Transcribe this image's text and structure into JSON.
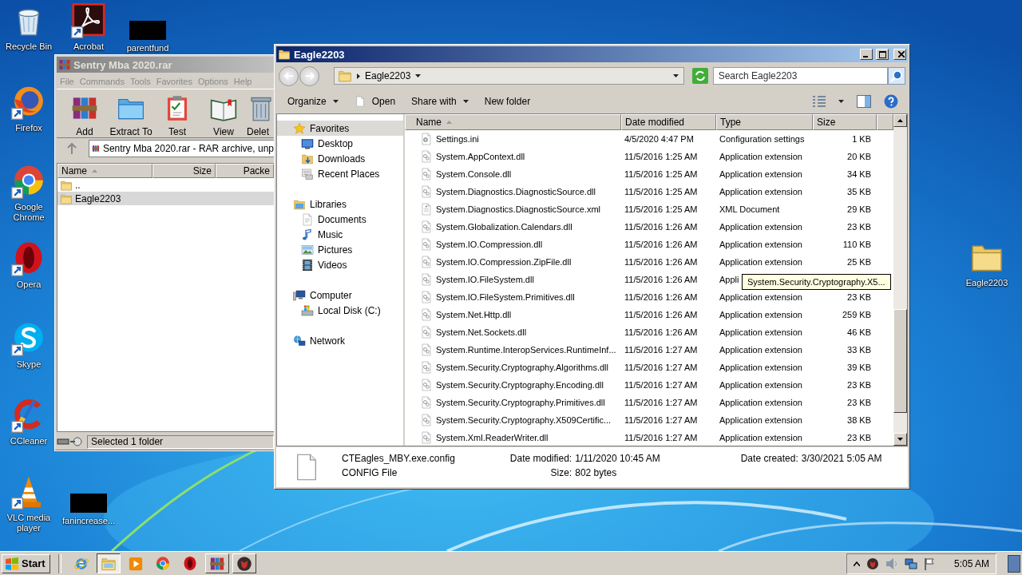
{
  "desktop_icons": [
    {
      "label": "Recycle Bin",
      "kind": "recycle",
      "shortcut": false
    },
    {
      "label": "Acrobat",
      "kind": "acrobat",
      "shortcut": true
    },
    {
      "label": "parentfund",
      "kind": "redacted",
      "shortcut": false
    },
    {
      "label": "Firefox",
      "kind": "firefox",
      "shortcut": true
    },
    {
      "label": "Google Chrome",
      "kind": "chrome",
      "shortcut": true
    },
    {
      "label": "Opera",
      "kind": "opera",
      "shortcut": true
    },
    {
      "label": "Skype",
      "kind": "skype",
      "shortcut": true
    },
    {
      "label": "CCleaner",
      "kind": "ccleaner",
      "shortcut": true
    },
    {
      "label": "VLC media player",
      "kind": "vlc",
      "shortcut": true
    },
    {
      "label": "fanincrease...",
      "kind": "redacted",
      "shortcut": false
    },
    {
      "label": "Eagle2203",
      "kind": "folder",
      "shortcut": false
    }
  ],
  "archiver": {
    "title": "Sentry Mba 2020.rar",
    "menu": [
      "File",
      "Commands",
      "Tools",
      "Favorites",
      "Options",
      "Help"
    ],
    "tools": [
      {
        "label": "Add",
        "kind": "add"
      },
      {
        "label": "Extract To",
        "kind": "extract"
      },
      {
        "label": "Test",
        "kind": "test"
      },
      {
        "label": "View",
        "kind": "view"
      },
      {
        "label": "Delet",
        "kind": "delete"
      }
    ],
    "path": "Sentry Mba 2020.rar - RAR archive, unp",
    "columns": [
      {
        "label": "Name",
        "sorted": true
      },
      {
        "label": "Size",
        "sorted": false
      },
      {
        "label": "Packe",
        "sorted": false
      }
    ],
    "rows": [
      {
        "name": "..",
        "selected": false
      },
      {
        "name": "Eagle2203",
        "selected": true
      }
    ],
    "status": "Selected 1 folder"
  },
  "explorer": {
    "title": "Eagle2203",
    "breadcrumb": "Eagle2203",
    "search": {
      "placeholder": "Search Eagle2203"
    },
    "commands": [
      {
        "label": "Organize",
        "kind": "menu"
      },
      {
        "label": "Open",
        "kind": "file"
      },
      {
        "label": "Share with",
        "kind": "menu"
      },
      {
        "label": "New folder",
        "kind": "plain"
      }
    ],
    "nav": [
      {
        "label": "Favorites",
        "kind": "star",
        "selected": true,
        "children": [
          {
            "label": "Desktop",
            "kind": "desktop",
            "selected": false
          },
          {
            "label": "Downloads",
            "kind": "downloads",
            "selected": false
          },
          {
            "label": "Recent Places",
            "kind": "recent",
            "selected": false
          }
        ]
      },
      {
        "label": "Libraries",
        "kind": "library",
        "selected": false,
        "children": [
          {
            "label": "Documents",
            "kind": "documents",
            "selected": false
          },
          {
            "label": "Music",
            "kind": "music",
            "selected": false
          },
          {
            "label": "Pictures",
            "kind": "pictures",
            "selected": false
          },
          {
            "label": "Videos",
            "kind": "videos",
            "selected": false
          }
        ]
      },
      {
        "label": "Computer",
        "kind": "computer",
        "selected": false,
        "children": [
          {
            "label": "Local Disk (C:)",
            "kind": "disk",
            "selected": false
          }
        ]
      },
      {
        "label": "Network",
        "kind": "network",
        "selected": false
      }
    ],
    "columns": [
      {
        "label": "Name",
        "sorted": true
      },
      {
        "label": "Date modified",
        "sorted": false
      },
      {
        "label": "Type",
        "sorted": false
      },
      {
        "label": "Size",
        "sorted": false
      }
    ],
    "files": [
      {
        "name": "Settings.ini",
        "kind": "ini",
        "date": "4/5/2020 4:47 PM",
        "type": "Configuration settings",
        "size": "1 KB"
      },
      {
        "name": "System.AppContext.dll",
        "kind": "dll",
        "date": "11/5/2016 1:25 AM",
        "type": "Application extension",
        "size": "20 KB"
      },
      {
        "name": "System.Console.dll",
        "kind": "dll",
        "date": "11/5/2016 1:25 AM",
        "type": "Application extension",
        "size": "34 KB"
      },
      {
        "name": "System.Diagnostics.DiagnosticSource.dll",
        "kind": "dll",
        "date": "11/5/2016 1:25 AM",
        "type": "Application extension",
        "size": "35 KB"
      },
      {
        "name": "System.Diagnostics.DiagnosticSource.xml",
        "kind": "xml",
        "date": "11/5/2016 1:25 AM",
        "type": "XML Document",
        "size": "29 KB"
      },
      {
        "name": "System.Globalization.Calendars.dll",
        "kind": "dll",
        "date": "11/5/2016 1:26 AM",
        "type": "Application extension",
        "size": "23 KB"
      },
      {
        "name": "System.IO.Compression.dll",
        "kind": "dll",
        "date": "11/5/2016 1:26 AM",
        "type": "Application extension",
        "size": "110 KB"
      },
      {
        "name": "System.IO.Compression.ZipFile.dll",
        "kind": "dll",
        "date": "11/5/2016 1:26 AM",
        "type": "Application extension",
        "size": "25 KB"
      },
      {
        "name": "System.IO.FileSystem.dll",
        "kind": "dll",
        "date": "11/5/2016 1:26 AM",
        "type": "Appli"
      },
      {
        "name": "System.IO.FileSystem.Primitives.dll",
        "kind": "dll",
        "date": "11/5/2016 1:26 AM",
        "type": "Application extension",
        "size": "23 KB"
      },
      {
        "name": "System.Net.Http.dll",
        "kind": "dll",
        "date": "11/5/2016 1:26 AM",
        "type": "Application extension",
        "size": "259 KB"
      },
      {
        "name": "System.Net.Sockets.dll",
        "kind": "dll",
        "date": "11/5/2016 1:26 AM",
        "type": "Application extension",
        "size": "46 KB"
      },
      {
        "name": "System.Runtime.InteropServices.RuntimeInf...",
        "kind": "dll",
        "date": "11/5/2016 1:27 AM",
        "type": "Application extension",
        "size": "33 KB"
      },
      {
        "name": "System.Security.Cryptography.Algorithms.dll",
        "kind": "dll",
        "date": "11/5/2016 1:27 AM",
        "type": "Application extension",
        "size": "39 KB"
      },
      {
        "name": "System.Security.Cryptography.Encoding.dll",
        "kind": "dll",
        "date": "11/5/2016 1:27 AM",
        "type": "Application extension",
        "size": "23 KB"
      },
      {
        "name": "System.Security.Cryptography.Primitives.dll",
        "kind": "dll",
        "date": "11/5/2016 1:27 AM",
        "type": "Application extension",
        "size": "23 KB"
      },
      {
        "name": "System.Security.Cryptography.X509Certific...",
        "kind": "dll",
        "date": "11/5/2016 1:27 AM",
        "type": "Application extension",
        "size": "38 KB"
      },
      {
        "name": "System.Xml.ReaderWriter.dll",
        "kind": "dll",
        "date": "11/5/2016 1:27 AM",
        "type": "Application extension",
        "size": "23 KB"
      }
    ],
    "tooltip": "System.Security.Cryptography.X5...",
    "details": {
      "name": "CTEagles_MBY.exe.config",
      "type": "CONFIG File",
      "fields": [
        {
          "label": "Date modified:",
          "value": "1/11/2020 10:45 AM"
        },
        {
          "label": "Size:",
          "value": "802 bytes"
        },
        {
          "label": "Date created:",
          "value": "3/30/2021 5:05 AM"
        }
      ]
    }
  },
  "taskbar": {
    "start": "Start",
    "items": [
      {
        "kind": "ie",
        "running": false,
        "selected": false
      },
      {
        "kind": "explorer",
        "running": true,
        "selected": true
      },
      {
        "kind": "media",
        "running": false,
        "selected": false
      },
      {
        "kind": "chrome",
        "running": false,
        "selected": false
      },
      {
        "kind": "opera",
        "running": false,
        "selected": false
      },
      {
        "kind": "winrar",
        "running": true,
        "selected": false
      },
      {
        "kind": "app",
        "running": true,
        "selected": false
      }
    ],
    "clock": "5:05 AM"
  }
}
